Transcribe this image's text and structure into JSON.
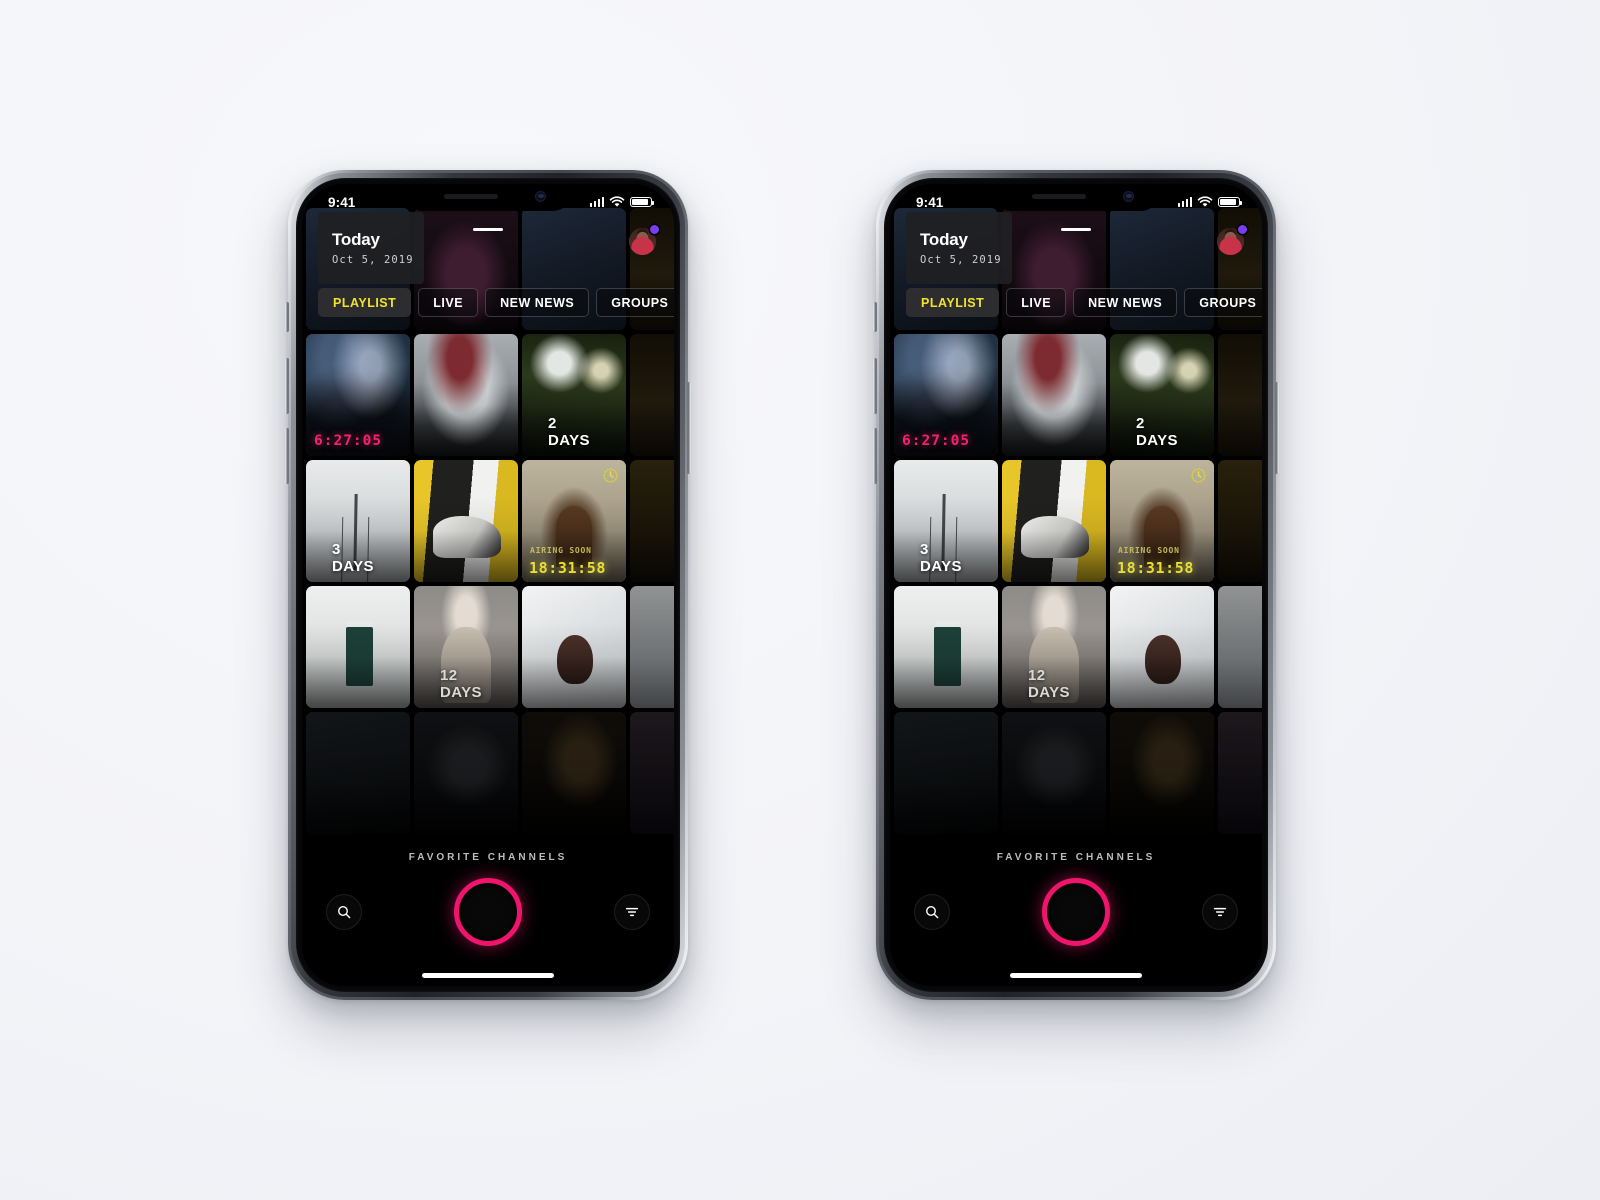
{
  "background_color": "#f3f4f8",
  "phones": [
    "left",
    "right"
  ],
  "status_bar": {
    "time": "9:41",
    "signal_icon": "cellular-signal-icon",
    "wifi_icon": "wifi-icon",
    "battery_icon": "battery-icon"
  },
  "header": {
    "drag_handle": "drag-handle",
    "title": "Today",
    "date": "Oct 5, 2019",
    "avatar": "user-avatar",
    "notification_dot_color": "#7b3cf0"
  },
  "tabs": [
    {
      "label": "PLAYLIST",
      "active": true
    },
    {
      "label": "LIVE",
      "active": false
    },
    {
      "label": "NEW NEWS",
      "active": false
    },
    {
      "label": "GROUPS",
      "active": false
    }
  ],
  "tab_active_color": "#f2e32b",
  "grid": {
    "rows": [
      [
        {
          "name": "tile-galaxy",
          "photo": "ph-galaxy",
          "overlay": "6:27:05",
          "overlay_type": "countdown-pink",
          "active": true
        },
        {
          "name": "tile-street",
          "photo": "ph-street",
          "overlay": "",
          "overlay_type": "none"
        },
        {
          "name": "tile-cafe",
          "photo": "ph-cafe",
          "overlay": "2 DAYS",
          "overlay_type": "days"
        }
      ],
      [
        {
          "name": "tile-tower",
          "photo": "ph-tower",
          "overlay": "3 DAYS",
          "overlay_type": "days"
        },
        {
          "name": "tile-sneaker",
          "photo": "ph-shoe",
          "overlay": "",
          "overlay_type": "none"
        },
        {
          "name": "tile-door",
          "photo": "ph-door",
          "overlay": "18:31:58",
          "overlay_type": "airing-soon",
          "badge": "AIRING SOON",
          "clock_icon": "clock-icon"
        }
      ],
      [
        {
          "name": "tile-shrine",
          "photo": "ph-shrine",
          "overlay": "",
          "overlay_type": "none"
        },
        {
          "name": "tile-model",
          "photo": "ph-model",
          "overlay": "12 DAYS",
          "overlay_type": "days-muted"
        },
        {
          "name": "tile-joy",
          "photo": "ph-joy",
          "overlay": "",
          "overlay_type": "none"
        }
      ],
      [
        {
          "name": "tile-bottom-1",
          "photo": "ph-dark1",
          "overlay": "",
          "overlay_type": "none"
        },
        {
          "name": "tile-bottom-2",
          "photo": "ph-dark2",
          "overlay": "",
          "overlay_type": "none"
        },
        {
          "name": "tile-bottom-3",
          "photo": "ph-dark3",
          "overlay": "",
          "overlay_type": "none"
        }
      ]
    ],
    "edge_left": [
      "ph-edgeA",
      "ph-edgeB",
      "ph-edgeE",
      "ph-edgeG"
    ],
    "edge_right": [
      "ph-edgeC",
      "ph-edgeD",
      "ph-edgeF",
      "ph-edgeE"
    ],
    "top_partial": [
      "ph-bluebuild",
      "ph-purple",
      "ph-bluebuild"
    ]
  },
  "colors": {
    "countdown_pink": "#f0246c",
    "airing_yellow": "#e8de3a",
    "record_ring": "#f0146d",
    "active_tile_border": "#e81b60"
  },
  "bottom_bar": {
    "favorites_label": "FAVORITE CHANNELS",
    "search_icon": "search-icon",
    "record_button": "record-button",
    "filter_icon": "filter-icon"
  },
  "home_indicator": "home-indicator"
}
